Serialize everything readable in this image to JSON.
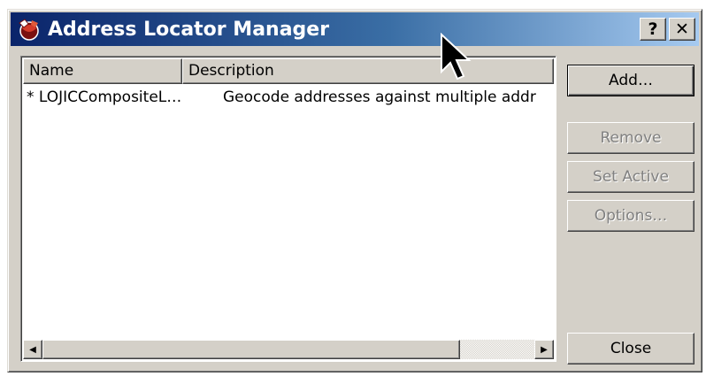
{
  "window": {
    "title": "Address Locator Manager",
    "help_label": "?",
    "close_label": "✕"
  },
  "list": {
    "columns": [
      "Name",
      "Description"
    ],
    "rows": [
      {
        "name": "* LOJICCompositeL…",
        "description": "Geocode addresses against multiple addr"
      }
    ]
  },
  "buttons": {
    "add": "Add…",
    "remove": "Remove",
    "set_active": "Set Active",
    "options": "Options…",
    "close": "Close"
  },
  "scrollbar": {
    "left_arrow": "◀",
    "right_arrow": "▶"
  },
  "icons": {
    "title": "address-locator-globe-icon",
    "cursor": "mouse-pointer-icon"
  },
  "colors": {
    "titlebar_start": "#0a246a",
    "titlebar_end": "#a6caf0",
    "face": "#d4d0c8",
    "disabled_text": "#808080"
  }
}
